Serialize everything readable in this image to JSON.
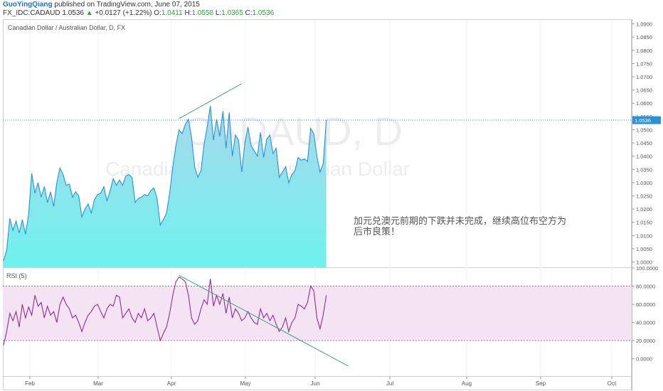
{
  "header": {
    "author": "GuoYingQiang",
    "published": "published on TradingView.com, June 07, 2015",
    "symbol": "FX_IDC:CADAUD",
    "last": "1.0536",
    "change": "+0.0127 (+1.22%)",
    "o_label": "O:",
    "o_value": "1.0411",
    "h_label": "H:",
    "h_value": "1.0558",
    "l_label": "L:",
    "l_value": "1.0365",
    "c_label": "C:",
    "c_value": "1.0536"
  },
  "main_panel_label": "Canadian Dollar / Australian Dollar, D, FX",
  "rsi_panel_label": "RSI (5)",
  "watermark": {
    "line1": "CADAUD, D",
    "line2": "Canadian Dollar / Australian Dollar"
  },
  "annotation_text": "加元兑澳元前期的下跌并未完成，继续高位布空方为后市良策！",
  "colors": {
    "price_line": "#2a90d8",
    "area_top": "#a8d8ea",
    "area_bottom": "#6ef2ee",
    "rsi_line": "#8e2d8e",
    "rsi_band": "#f4e4f3",
    "trend_line": "#3aa57a",
    "last_price_badge": "#2a90d8"
  },
  "chart_data": [
    {
      "type": "area",
      "title": "Canadian Dollar / Australian Dollar, D, FX",
      "y_ticks": [
        "1.0900",
        "1.0850",
        "1.0800",
        "1.0750",
        "1.0700",
        "1.0650",
        "1.0600",
        "1.0550",
        "1.0500",
        "1.0450",
        "1.0400",
        "1.0350",
        "1.0300",
        "1.0250",
        "1.0200",
        "1.0150",
        "1.0100",
        "1.0050",
        "1.0000"
      ],
      "ylim": [
        0.998,
        1.0915
      ],
      "last_value": 1.0536,
      "last_value_label": "1.0536",
      "x_labels": [
        "Feb",
        "Mar",
        "Apr",
        "May",
        "Jun",
        "Jul",
        "Aug",
        "Sep",
        "Oct"
      ],
      "values": [
        1.0005,
        1.0045,
        1.0165,
        1.012,
        1.0155,
        1.011,
        1.016,
        1.0105,
        1.018,
        1.0335,
        1.026,
        1.03,
        1.0245,
        1.0285,
        1.0225,
        1.0265,
        1.021,
        1.03,
        1.0355,
        1.033,
        1.029,
        1.0295,
        1.0245,
        1.0265,
        1.025,
        1.017,
        1.02,
        1.022,
        1.0185,
        1.0235,
        1.0255,
        1.026,
        1.0285,
        1.023,
        1.027,
        1.0315,
        1.029,
        1.031,
        1.029,
        1.0325,
        1.033,
        1.032,
        1.0225,
        1.024,
        1.0245,
        1.0255,
        1.025,
        1.027,
        1.028,
        1.024,
        1.014,
        1.016,
        1.0185,
        1.026,
        1.036,
        1.044,
        1.05,
        1.0485,
        1.052,
        1.054,
        1.047,
        1.036,
        1.032,
        1.0345,
        1.0445,
        1.051,
        1.059,
        1.046,
        1.054,
        1.0475,
        1.057,
        1.043,
        1.0565,
        1.04,
        1.048,
        1.046,
        1.034,
        1.045,
        1.051,
        1.044,
        1.042,
        1.04,
        1.049,
        1.0395,
        1.0465,
        1.048,
        1.041,
        1.043,
        1.032,
        1.034,
        1.036,
        1.03,
        1.033,
        1.0345,
        1.0395,
        1.0385,
        1.039,
        1.038,
        1.0505,
        1.0485,
        1.04,
        1.034,
        1.037,
        1.0536
      ],
      "annotations": [
        {
          "type": "trendline",
          "from": [
            56,
            1.0542
          ],
          "to": [
            76,
            1.0674
          ]
        }
      ]
    },
    {
      "type": "line",
      "title": "RSI (5)",
      "y_ticks": [
        "100.0000",
        "80.0000",
        "60.0000",
        "40.0000",
        "20.0000",
        "0.0000"
      ],
      "ylim": [
        -12,
        100
      ],
      "band": [
        20,
        80
      ],
      "values": [
        15,
        30,
        50,
        42,
        52,
        35,
        60,
        45,
        57,
        48,
        70,
        58,
        62,
        45,
        58,
        48,
        52,
        40,
        60,
        68,
        60,
        55,
        45,
        48,
        40,
        30,
        40,
        48,
        52,
        58,
        60,
        52,
        45,
        55,
        60,
        58,
        70,
        68,
        45,
        50,
        55,
        45,
        40,
        50,
        45,
        55,
        42,
        45,
        50,
        35,
        20,
        28,
        35,
        50,
        70,
        85,
        90,
        88,
        85,
        70,
        45,
        38,
        42,
        55,
        65,
        60,
        88,
        58,
        70,
        60,
        72,
        50,
        68,
        45,
        55,
        50,
        42,
        45,
        52,
        45,
        40,
        38,
        55,
        45,
        50,
        42,
        48,
        38,
        30,
        35,
        45,
        30,
        40,
        45,
        60,
        58,
        55,
        62,
        80,
        75,
        45,
        33,
        48,
        70
      ],
      "annotations": [
        {
          "type": "trendline",
          "from": [
            56,
            92
          ],
          "to": [
            110,
            -8
          ]
        }
      ]
    }
  ]
}
